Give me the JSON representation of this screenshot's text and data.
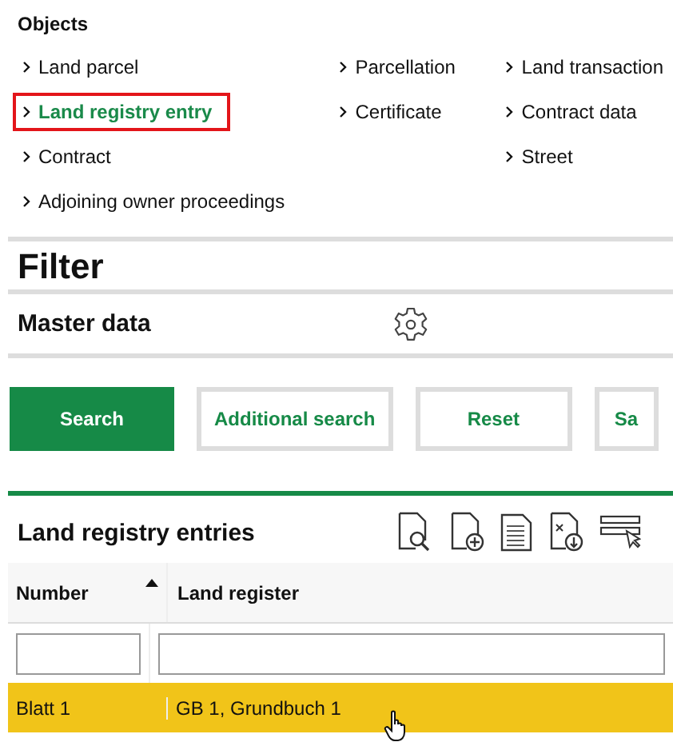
{
  "objects": {
    "title": "Objects",
    "columns": [
      [
        {
          "label": "Land parcel",
          "selected": false
        },
        {
          "label": "Land registry entry",
          "selected": true
        },
        {
          "label": "Contract",
          "selected": false
        },
        {
          "label": "Adjoining owner proceedings",
          "selected": false
        }
      ],
      [
        {
          "label": "Parcellation",
          "selected": false
        },
        {
          "label": "Certificate",
          "selected": false
        }
      ],
      [
        {
          "label": "Land transaction",
          "selected": false
        },
        {
          "label": "Contract data",
          "selected": false
        },
        {
          "label": "Street",
          "selected": false
        }
      ]
    ]
  },
  "filter": {
    "title": "Filter",
    "section": "Master data"
  },
  "buttons": [
    {
      "label": "Search",
      "kind": "primary"
    },
    {
      "label": "Additional search",
      "kind": "secondary"
    },
    {
      "label": "Reset",
      "kind": "secondary"
    },
    {
      "label": "Sa",
      "kind": "secondary"
    }
  ],
  "table": {
    "title": "Land registry entries",
    "columns": [
      {
        "label": "Number",
        "sorted": true
      },
      {
        "label": "Land register",
        "sorted": false
      }
    ],
    "rows": [
      {
        "cells": [
          "Blatt 1",
          "GB 1, Grundbuch 1"
        ],
        "selected": true
      }
    ]
  }
}
